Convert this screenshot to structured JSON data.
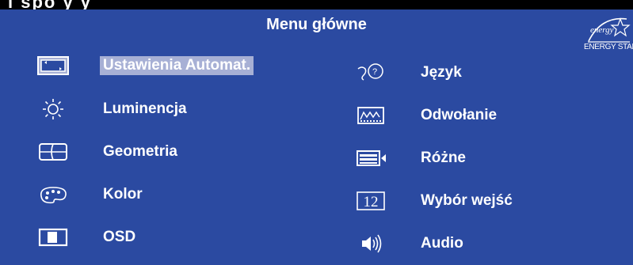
{
  "header": {
    "top_strip_text": "i spo y y",
    "title": "Menu główne",
    "energy_label": "ENERGY STAR",
    "energy_script": "energy"
  },
  "menu": {
    "left": [
      {
        "label": "Ustawienia Automat.",
        "icon": "auto-adjust-icon",
        "selected": true
      },
      {
        "label": "Luminencja",
        "icon": "brightness-icon",
        "selected": false
      },
      {
        "label": "Geometria",
        "icon": "geometry-icon",
        "selected": false
      },
      {
        "label": "Kolor",
        "icon": "color-palette-icon",
        "selected": false
      },
      {
        "label": "OSD",
        "icon": "osd-icon",
        "selected": false
      }
    ],
    "right": [
      {
        "label": "Język",
        "icon": "language-icon",
        "selected": false
      },
      {
        "label": "Odwołanie",
        "icon": "recall-icon",
        "selected": false
      },
      {
        "label": "Różne",
        "icon": "misc-icon",
        "selected": false
      },
      {
        "label": "Wybór wejść",
        "icon": "input-select-icon",
        "icon_text": "12",
        "selected": false
      },
      {
        "label": "Audio",
        "icon": "audio-icon",
        "selected": false
      }
    ]
  },
  "colors": {
    "panel": "#2b4aa1",
    "selection": "#a7b0d5",
    "text": "#ffffff"
  }
}
